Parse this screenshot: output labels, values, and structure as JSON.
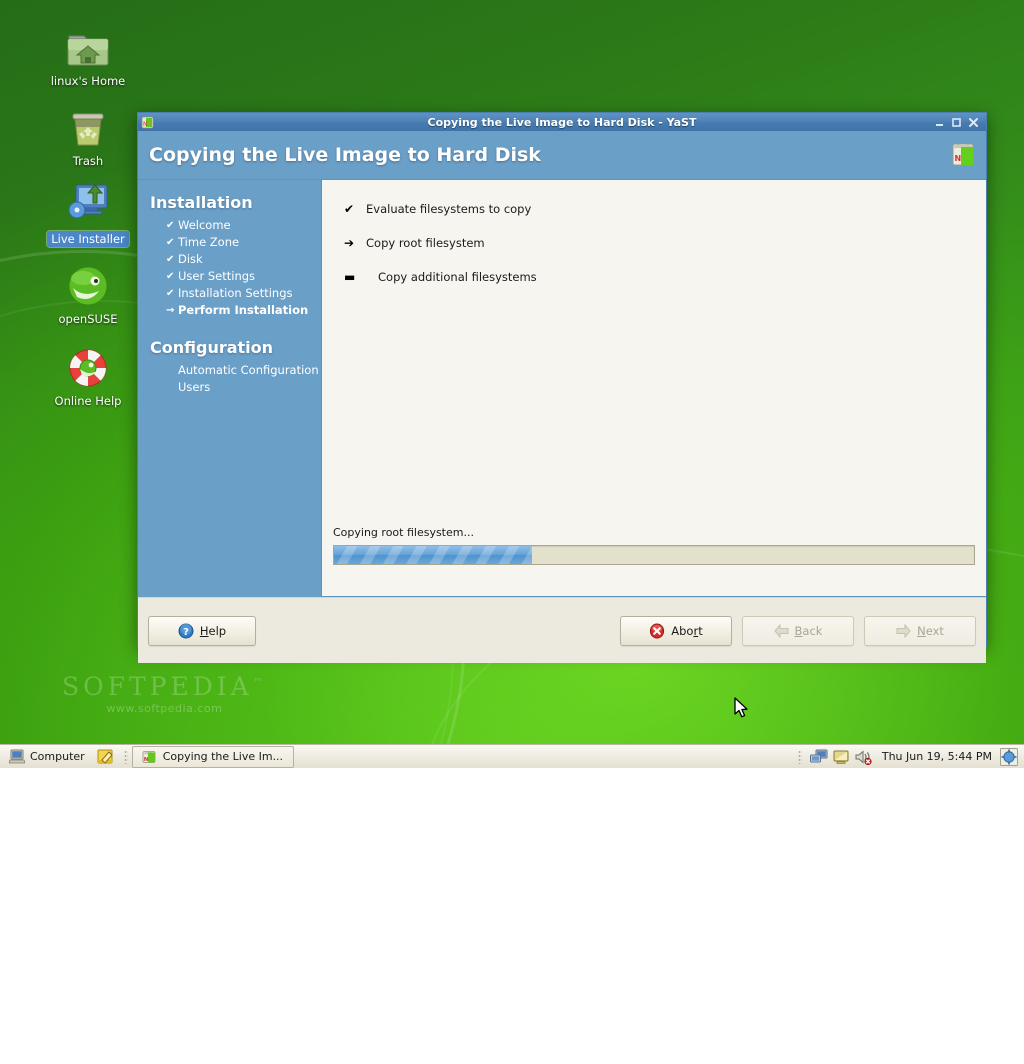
{
  "desktop": {
    "icons": [
      {
        "name": "home-folder",
        "label": "linux's Home",
        "selected": false
      },
      {
        "name": "trash",
        "label": "Trash",
        "selected": false
      },
      {
        "name": "live-installer",
        "label": "Live Installer",
        "selected": true
      },
      {
        "name": "opensuse",
        "label": "openSUSE",
        "selected": false
      },
      {
        "name": "online-help",
        "label": "Online Help",
        "selected": false
      }
    ],
    "watermark": {
      "brand": "SOFTPEDIA",
      "tm": "™",
      "url": "www.softpedia.com"
    }
  },
  "window": {
    "titlebar": {
      "title": "Copying the Live Image to Hard Disk - YaST",
      "minimize": "—",
      "maximize": "□",
      "close": "✕"
    },
    "banner": {
      "title": "Copying the Live Image to Hard Disk"
    },
    "sidebar": {
      "installation_heading": "Installation",
      "installation_steps": [
        {
          "mark": "✔",
          "label": "Welcome",
          "state": "done"
        },
        {
          "mark": "✔",
          "label": "Time Zone",
          "state": "done"
        },
        {
          "mark": "✔",
          "label": "Disk",
          "state": "done"
        },
        {
          "mark": "✔",
          "label": "User Settings",
          "state": "done"
        },
        {
          "mark": "✔",
          "label": "Installation Settings",
          "state": "done"
        },
        {
          "mark": "→",
          "label": "Perform Installation",
          "state": "current"
        }
      ],
      "configuration_heading": "Configuration",
      "configuration_steps": [
        {
          "mark": "",
          "label": "Automatic Configuration",
          "state": "pending"
        },
        {
          "mark": "",
          "label": "Users",
          "state": "pending"
        }
      ]
    },
    "content": {
      "tasks": [
        {
          "mark": "✔",
          "label": "Evaluate filesystems to copy",
          "state": "done",
          "indent": false
        },
        {
          "mark": "➔",
          "label": "Copy root filesystem",
          "state": "current",
          "indent": false
        },
        {
          "mark": "▬",
          "label": "Copy additional filesystems",
          "state": "pending",
          "indent": true
        }
      ],
      "progress": {
        "label": "Copying root filesystem...",
        "percent": 31
      }
    },
    "buttons": {
      "help": {
        "label": "Help",
        "accel": "H",
        "icon": "help-icon",
        "enabled": true
      },
      "abort": {
        "label": "Abort",
        "accel": "r",
        "icon": "abort-icon",
        "enabled": true
      },
      "back": {
        "label": "Back",
        "accel": "B",
        "icon": "back-arrow-icon",
        "enabled": false
      },
      "next": {
        "label": "Next",
        "accel": "N",
        "icon": "next-arrow-icon",
        "enabled": false
      }
    }
  },
  "taskbar": {
    "computer": {
      "label": "Computer",
      "icon": "computer-icon"
    },
    "notes_icon": "notes-icon",
    "task": {
      "label": "Copying the Live Im...",
      "icon": "yast-icon"
    },
    "tray_icons": [
      "network-icon",
      "display-icon",
      "volume-muted-icon"
    ],
    "clock": "Thu Jun 19,  5:44 PM",
    "pager_icon": "desktop-pager-icon"
  },
  "colors": {
    "accent_blue": "#6a9fc8",
    "titlebar_blue": "#4e82b6",
    "progress_fill": "#66a3d6",
    "progress_track": "#e3e0cb",
    "content_bg": "#f6f5ef",
    "desktop_green": "#3a9a1a"
  }
}
